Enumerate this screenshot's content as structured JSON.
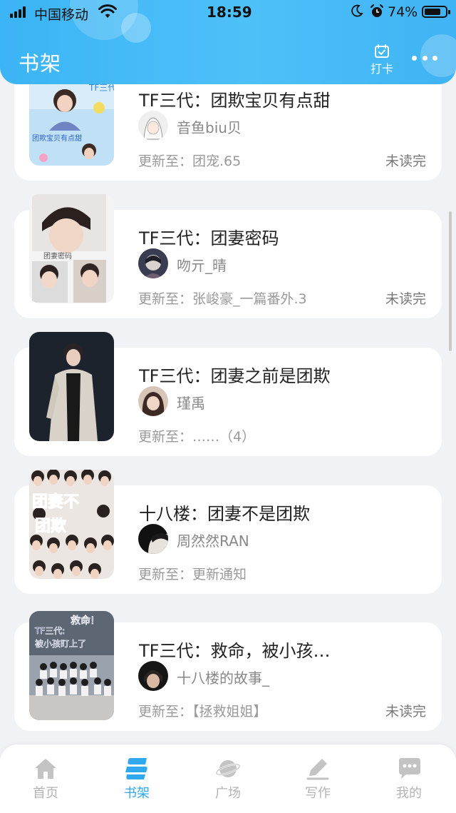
{
  "status_bar": {
    "carrier": "中国移动",
    "time": "18:59",
    "battery": "74%"
  },
  "header": {
    "title": "书架",
    "checkin_label": "打卡"
  },
  "books": [
    {
      "title": "TF三代：团欺宝贝有点甜",
      "author": "音鱼biu贝",
      "update": "更新至：团宠.65",
      "status": "未读完"
    },
    {
      "title": "TF三代：团妻密码",
      "author": "吻亓_晴",
      "update": "更新至：张峻豪_一篇番外.3",
      "status": "未读完"
    },
    {
      "title": "TF三代：团妻之前是团欺",
      "author": "瑾禹",
      "update": "更新至：……（4）",
      "status": ""
    },
    {
      "title": "十八楼：团妻不是团欺",
      "author": "周然然RAN",
      "update": "更新至：更新通知",
      "status": ""
    },
    {
      "title": "TF三代：救命，被小孩…",
      "author": "十八楼的故事_",
      "update": "更新至：【拯救姐姐】",
      "status": "未读完"
    }
  ],
  "tabs": [
    {
      "label": "首页",
      "icon": "home-icon"
    },
    {
      "label": "书架",
      "icon": "bookshelf-icon"
    },
    {
      "label": "广场",
      "icon": "planet-icon"
    },
    {
      "label": "写作",
      "icon": "pen-icon"
    },
    {
      "label": "我的",
      "icon": "chat-bubble-icon"
    }
  ],
  "colors": {
    "header": "#3bb4f5",
    "active_tab": "#2fa8f0",
    "background": "#f1f2f5"
  }
}
